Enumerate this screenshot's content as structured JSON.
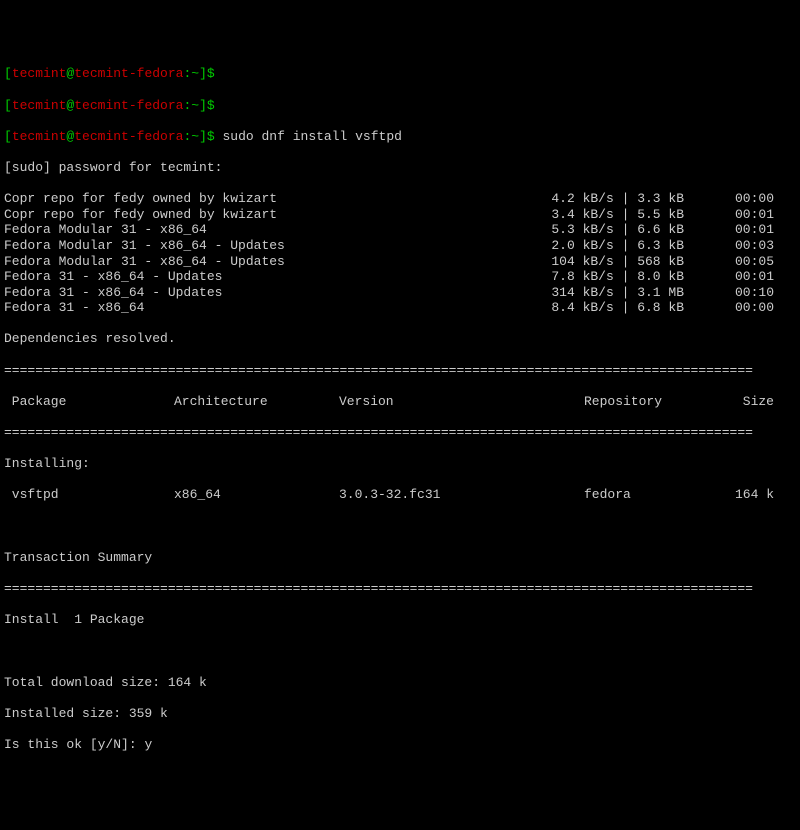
{
  "prompt": {
    "bracket_open": "[",
    "bracket_close": "]",
    "user": "tecmint",
    "at": "@",
    "host": "tecmint-fedora",
    "path": ":~",
    "symbol": "$"
  },
  "command": "sudo dnf install vsftpd",
  "sudo_line": "[sudo] password for tecmint:",
  "repos": [
    {
      "name": "Copr repo for fedy owned by kwizart",
      "speed": "4.2 kB/s | 3.3 kB",
      "time": "00:00"
    },
    {
      "name": "Copr repo for fedy owned by kwizart",
      "speed": "3.4 kB/s | 5.5 kB",
      "time": "00:01"
    },
    {
      "name": "Fedora Modular 31 - x86_64",
      "speed": "5.3 kB/s | 6.6 kB",
      "time": "00:01"
    },
    {
      "name": "Fedora Modular 31 - x86_64 - Updates",
      "speed": "2.0 kB/s | 6.3 kB",
      "time": "00:03"
    },
    {
      "name": "Fedora Modular 31 - x86_64 - Updates",
      "speed": "104 kB/s | 568 kB",
      "time": "00:05"
    },
    {
      "name": "Fedora 31 - x86_64 - Updates",
      "speed": "7.8 kB/s | 8.0 kB",
      "time": "00:01"
    },
    {
      "name": "Fedora 31 - x86_64 - Updates",
      "speed": "314 kB/s | 3.1 MB",
      "time": "00:10"
    },
    {
      "name": "Fedora 31 - x86_64",
      "speed": "8.4 kB/s | 6.8 kB",
      "time": "00:00"
    }
  ],
  "deps_resolved": "Dependencies resolved.",
  "divider": "================================================================================================",
  "headers": {
    "package": " Package",
    "arch": "Architecture",
    "version": "Version",
    "repo": "Repository",
    "size": "Size"
  },
  "installing_label": "Installing:",
  "pkg": {
    "name": " vsftpd",
    "arch": "x86_64",
    "version": "3.0.3-32.fc31",
    "repo": "fedora",
    "size": "164 k"
  },
  "transaction_summary": "Transaction Summary",
  "install_count": "Install  1 Package",
  "download_size": "Total download size: 164 k",
  "installed_size": "Installed size: 359 k",
  "confirm_prompt": "Is this ok [y/N]: ",
  "confirm_answer": "y"
}
